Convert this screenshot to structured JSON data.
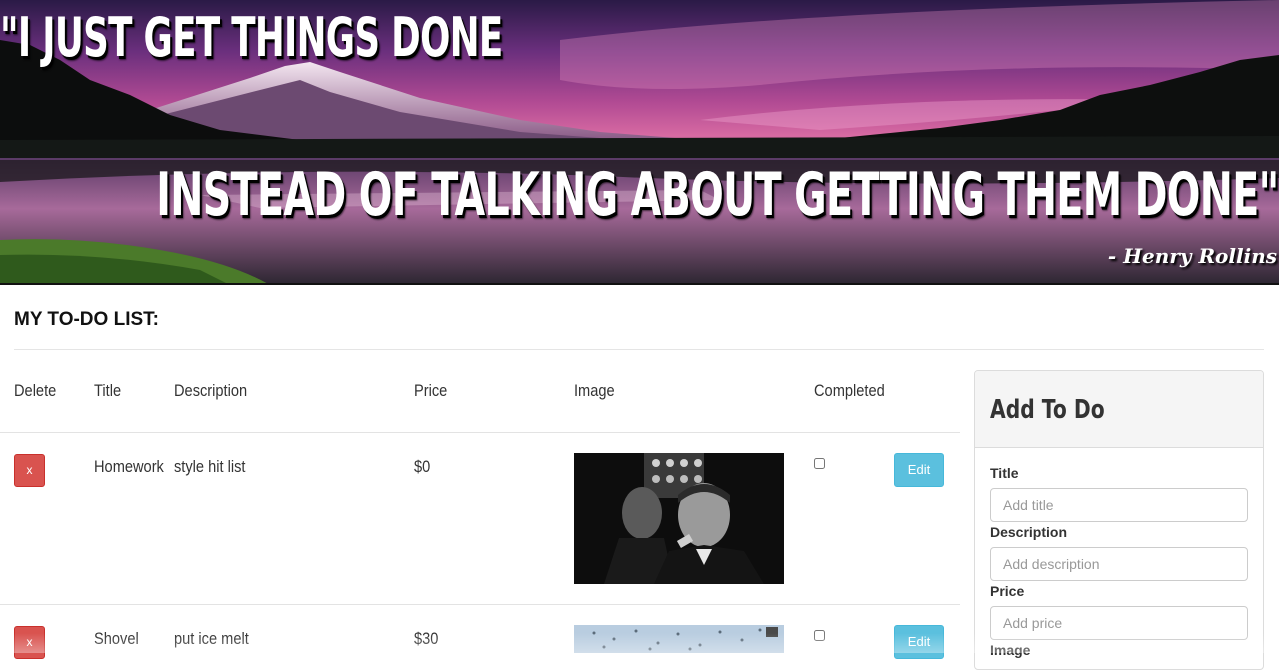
{
  "hero": {
    "quote_line_1": "\"I just get things done",
    "quote_line_2": "instead of talking about getting them done\"",
    "author": "- Henry Rollins"
  },
  "list": {
    "heading": "MY TO-DO LIST:",
    "columns": {
      "delete": "Delete",
      "title": "Title",
      "description": "Description",
      "price": "Price",
      "image": "Image",
      "completed": "Completed"
    },
    "rows": [
      {
        "delete_label": "x",
        "title": "Homework",
        "description": "style hit list",
        "price": "$0",
        "image_icon": "black-and-white-movie-still",
        "completed": false,
        "edit_label": "Edit"
      },
      {
        "delete_label": "x",
        "title": "Shovel",
        "description": "put ice melt",
        "price": "$30",
        "image_icon": "snowy-sky-photo",
        "completed": false,
        "edit_label": "Edit"
      }
    ]
  },
  "add_panel": {
    "title": "Add To Do",
    "fields": {
      "title": {
        "label": "Title",
        "placeholder": "Add title"
      },
      "description": {
        "label": "Description",
        "placeholder": "Add description"
      },
      "price": {
        "label": "Price",
        "placeholder": "Add price"
      },
      "image": {
        "label": "Image"
      }
    }
  },
  "colors": {
    "delete_button": "#d9534f",
    "edit_button": "#5bc0de",
    "panel_header_bg": "#f5f5f5"
  }
}
